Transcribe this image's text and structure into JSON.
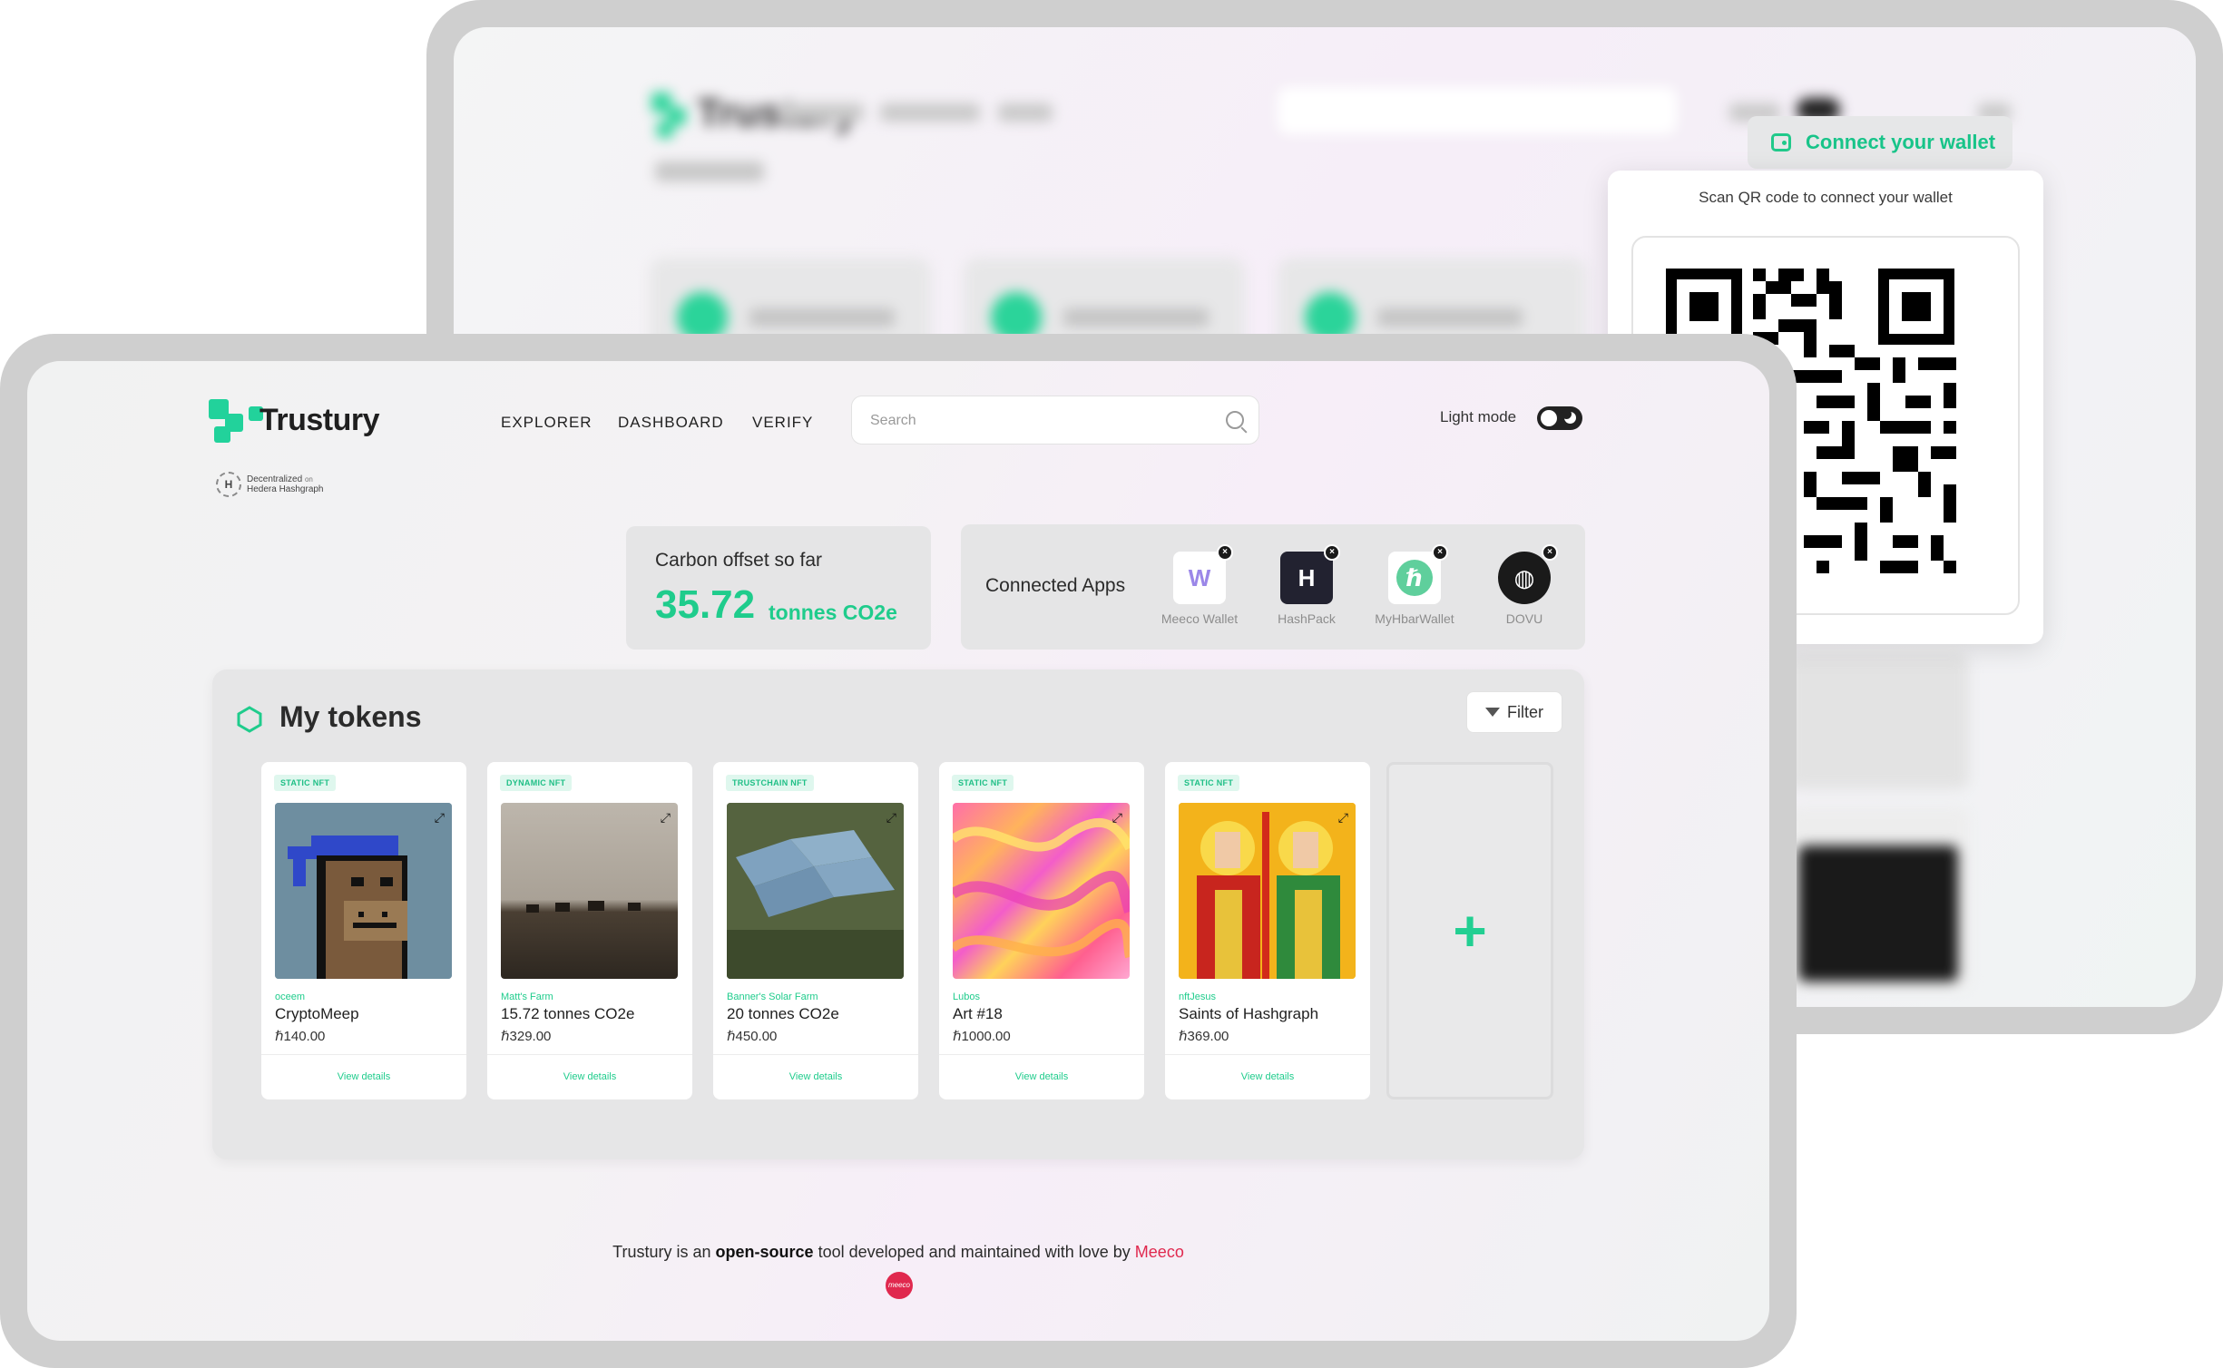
{
  "back_window": {
    "brand": "Trustury",
    "connect_wallet_label": "Connect your wallet",
    "qr_title": "Scan QR code to connect your wallet"
  },
  "front_window": {
    "brand": "Trustury",
    "hedera_badge": {
      "line1": "Decentralized",
      "line1_small": "on",
      "line2": "Hedera Hashgraph"
    },
    "nav": [
      "EXPLORER",
      "DASHBOARD",
      "VERIFY"
    ],
    "search": {
      "placeholder": "Search",
      "value": ""
    },
    "theme_toggle": {
      "label": "Light mode",
      "state": "dark"
    },
    "carbon": {
      "title": "Carbon offset so far",
      "value": "35.72",
      "unit": "tonnes CO2e"
    },
    "connected_apps": {
      "title": "Connected Apps",
      "apps": [
        {
          "label": "Meeco Wallet",
          "icon": "meeco-wallet-icon",
          "glyph": "W"
        },
        {
          "label": "HashPack",
          "icon": "hashpack-icon",
          "glyph": "H"
        },
        {
          "label": "MyHbarWallet",
          "icon": "myhbarwallet-icon",
          "glyph": "ℏ"
        },
        {
          "label": "DOVU",
          "icon": "dovu-icon",
          "glyph": "◍"
        }
      ]
    },
    "tokens": {
      "title": "My tokens",
      "filter_label": "Filter",
      "items": [
        {
          "tag": "STATIC NFT",
          "creator": "oceem",
          "name": "CryptoMeep",
          "price": "ℏ140.00",
          "details": "View details"
        },
        {
          "tag": "DYNAMIC NFT",
          "creator": "Matt's Farm",
          "name": "15.72 tonnes CO2e",
          "price": "ℏ329.00",
          "details": "View details"
        },
        {
          "tag": "TRUSTCHAIN NFT",
          "creator": "Banner's Solar Farm",
          "name": "20 tonnes CO2e",
          "price": "ℏ450.00",
          "details": "View details"
        },
        {
          "tag": "STATIC NFT",
          "creator": "Lubos",
          "name": "Art #18",
          "price": "ℏ1000.00",
          "details": "View details"
        },
        {
          "tag": "STATIC NFT",
          "creator": "nftJesus",
          "name": "Saints of Hashgraph",
          "price": "ℏ369.00",
          "details": "View details"
        }
      ],
      "add_label": "+"
    },
    "footer": {
      "prefix": "Trustury is an ",
      "bold": "open-source",
      "middle": " tool developed and maintained with love by ",
      "link": "Meeco",
      "logo_text": "meeco"
    }
  },
  "colors": {
    "accent": "#1fcc8c",
    "meeco": "#e0284e",
    "toggle": "#222222"
  }
}
